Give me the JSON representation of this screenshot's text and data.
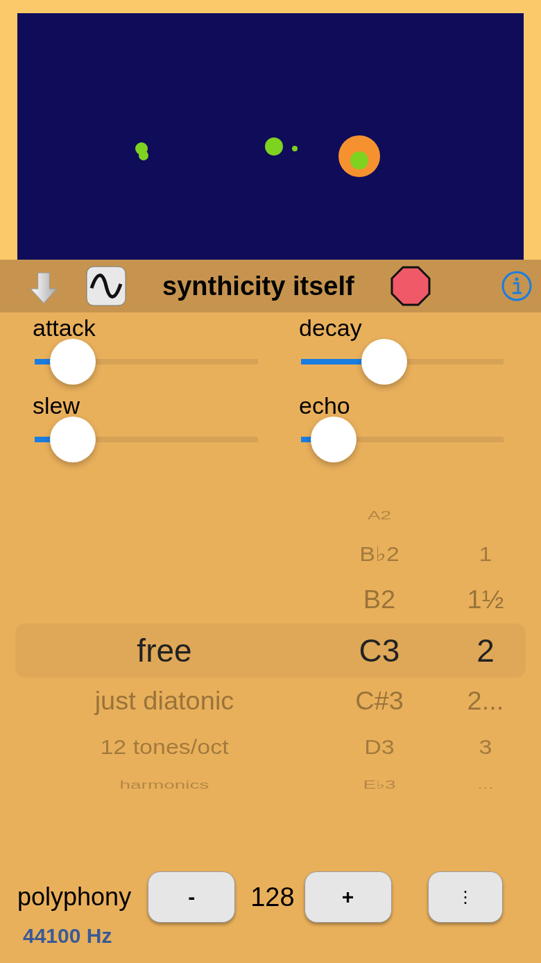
{
  "toolbar": {
    "title": "synthicity itself"
  },
  "sliders": [
    {
      "label": "attack",
      "level": 0.17
    },
    {
      "label": "decay",
      "level": 0.41
    },
    {
      "label": "slew",
      "level": 0.17
    },
    {
      "label": "echo",
      "level": 0.16
    }
  ],
  "picker": {
    "columns": [
      {
        "items": [
          {
            "label": "free",
            "selected": true
          },
          {
            "label": "just diatonic",
            "selected": false
          },
          {
            "label": "12 tones/oct",
            "selected": false
          },
          {
            "label": "harmonics",
            "selected": false
          }
        ]
      },
      {
        "items": [
          {
            "label": "A2",
            "selected": false
          },
          {
            "label": "B♭2",
            "selected": false
          },
          {
            "label": "B2",
            "selected": false
          },
          {
            "label": "C3",
            "selected": true
          },
          {
            "label": "C#3",
            "selected": false
          },
          {
            "label": "D3",
            "selected": false
          },
          {
            "label": "E♭3",
            "selected": false
          }
        ]
      },
      {
        "items": [
          {
            "label": "1",
            "selected": false
          },
          {
            "label": "1½",
            "selected": false
          },
          {
            "label": "2",
            "selected": true
          },
          {
            "label": "2...",
            "selected": false
          },
          {
            "label": "3",
            "selected": false
          },
          {
            "label": "...",
            "selected": false
          }
        ]
      }
    ]
  },
  "polyphony": {
    "label": "polyphony",
    "minus": "-",
    "value": "128",
    "plus": "+",
    "more": "⋮"
  },
  "sample_rate": "44100 Hz"
}
